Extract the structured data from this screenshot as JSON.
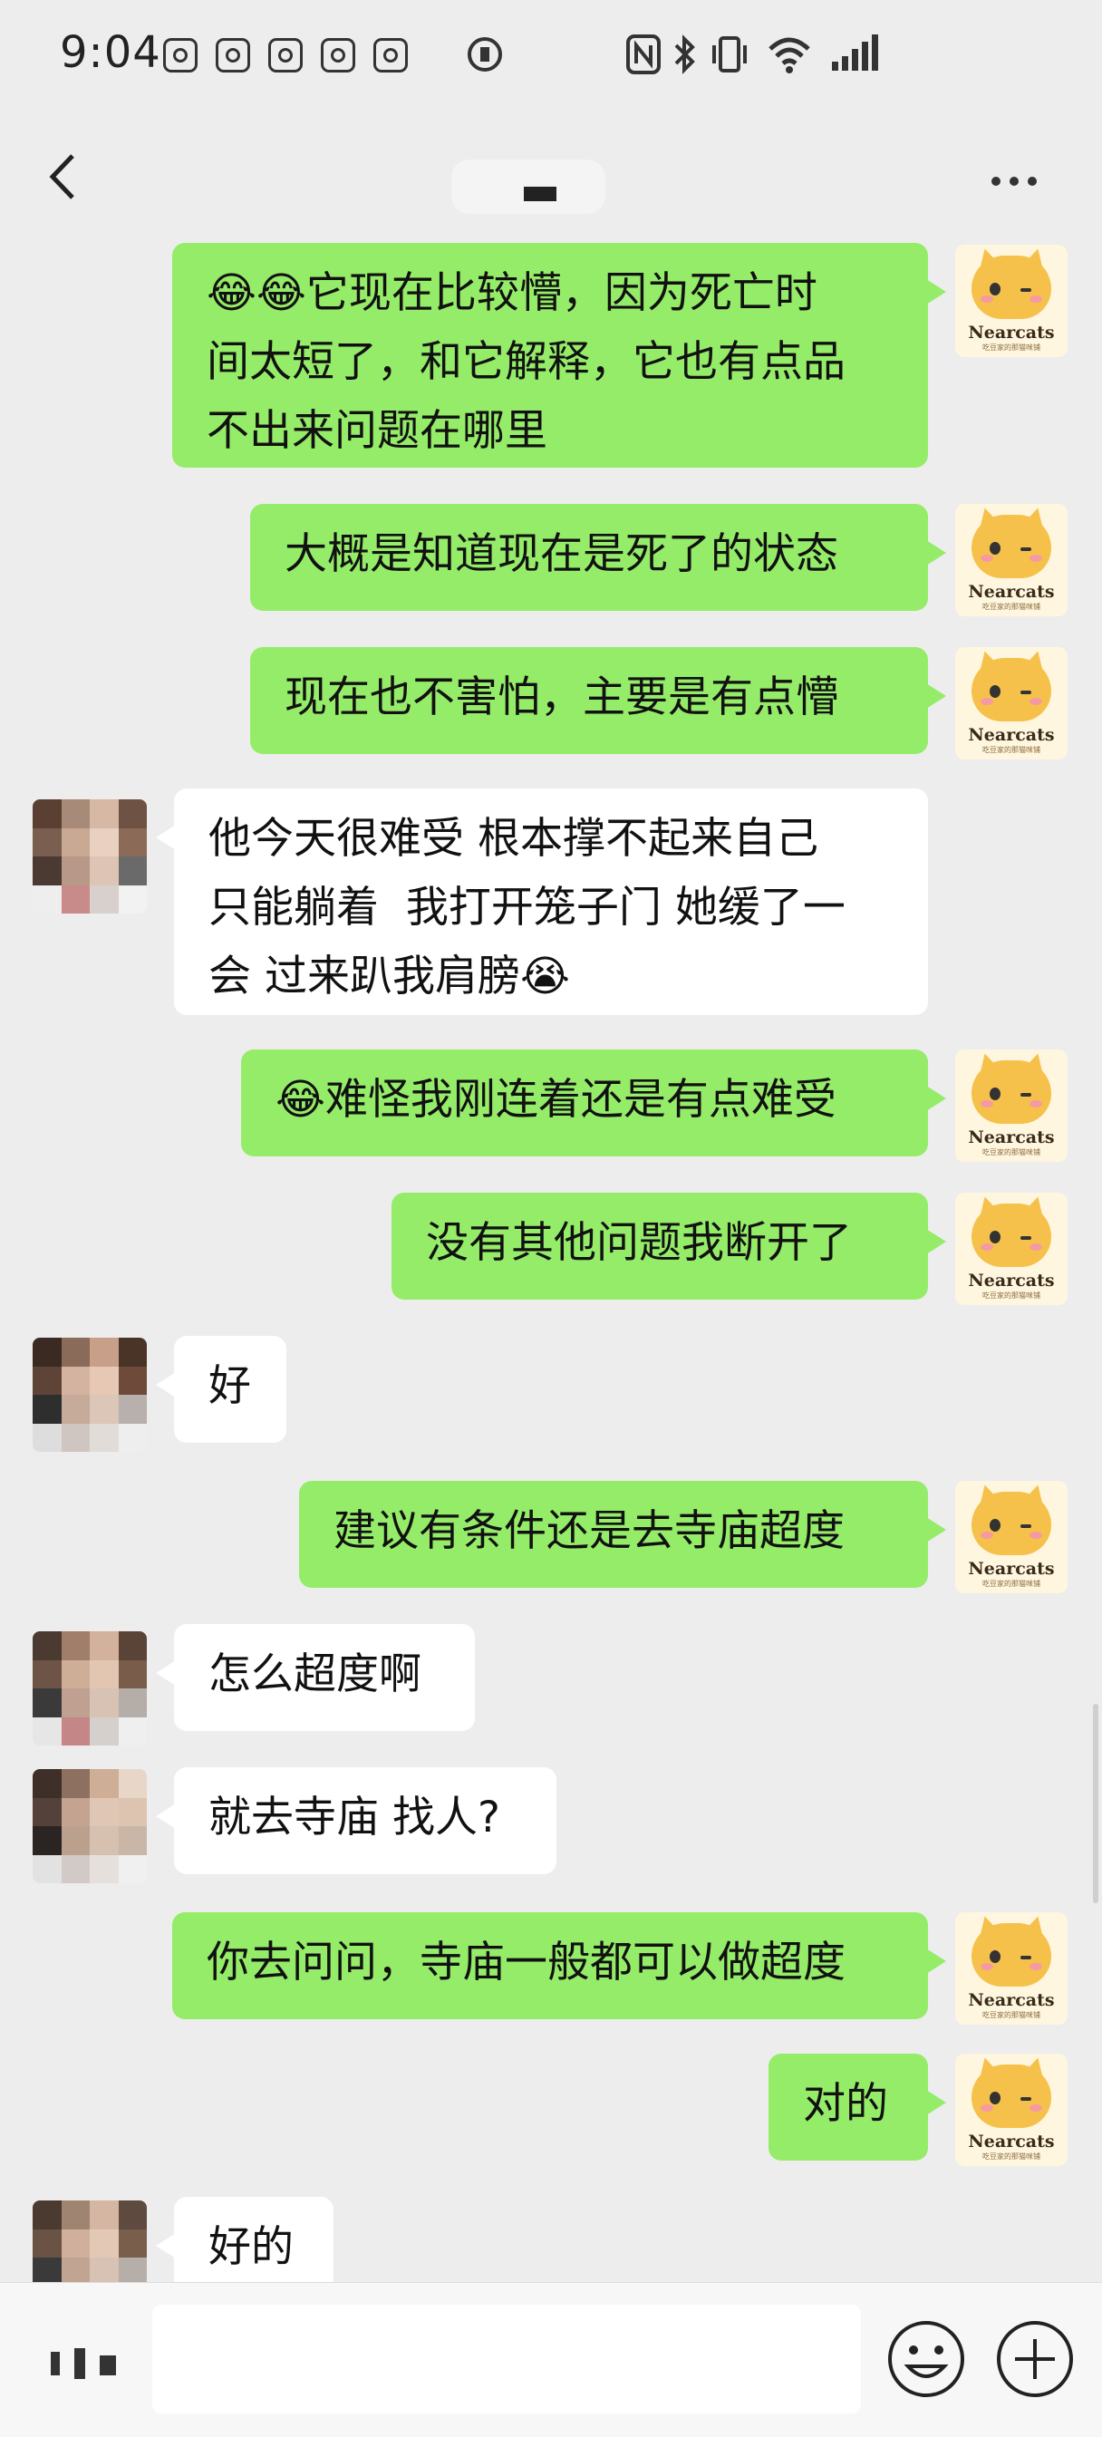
{
  "status_bar": {
    "time": "9:04"
  },
  "header": {
    "title": ""
  },
  "messages": [
    {
      "side": "out",
      "text": "😂😂它现在比较懵，因为死亡时\n间太短了，和它解释，它也有点品\n不出来问题在哪里"
    },
    {
      "side": "out",
      "text": "大概是知道现在是死了的状态"
    },
    {
      "side": "out",
      "text": "现在也不害怕，主要是有点懵"
    },
    {
      "side": "in",
      "text": "他今天很难受 根本撑不起来自己\n只能躺着  我打开笼子门 她缓了一\n会 过来趴我肩膀😭"
    },
    {
      "side": "out",
      "text": "😂难怪我刚连着还是有点难受"
    },
    {
      "side": "out",
      "text": "没有其他问题我断开了"
    },
    {
      "side": "in",
      "text": "好"
    },
    {
      "side": "out",
      "text": "建议有条件还是去寺庙超度"
    },
    {
      "side": "in",
      "text": "怎么超度啊"
    },
    {
      "side": "in",
      "text": "就去寺庙 找人?"
    },
    {
      "side": "out",
      "text": "你去问问，寺庙一般都可以做超度"
    },
    {
      "side": "out",
      "text": "对的"
    },
    {
      "side": "in",
      "text": "好的"
    }
  ],
  "avatar": {
    "brand": "Nearcats",
    "sub": "吃豆家的那猫咪铺"
  },
  "input": {
    "value": "",
    "placeholder": ""
  },
  "colors": {
    "outgoing_bubble": "#95ec69",
    "incoming_bubble": "#ffffff",
    "background": "#ededed"
  }
}
